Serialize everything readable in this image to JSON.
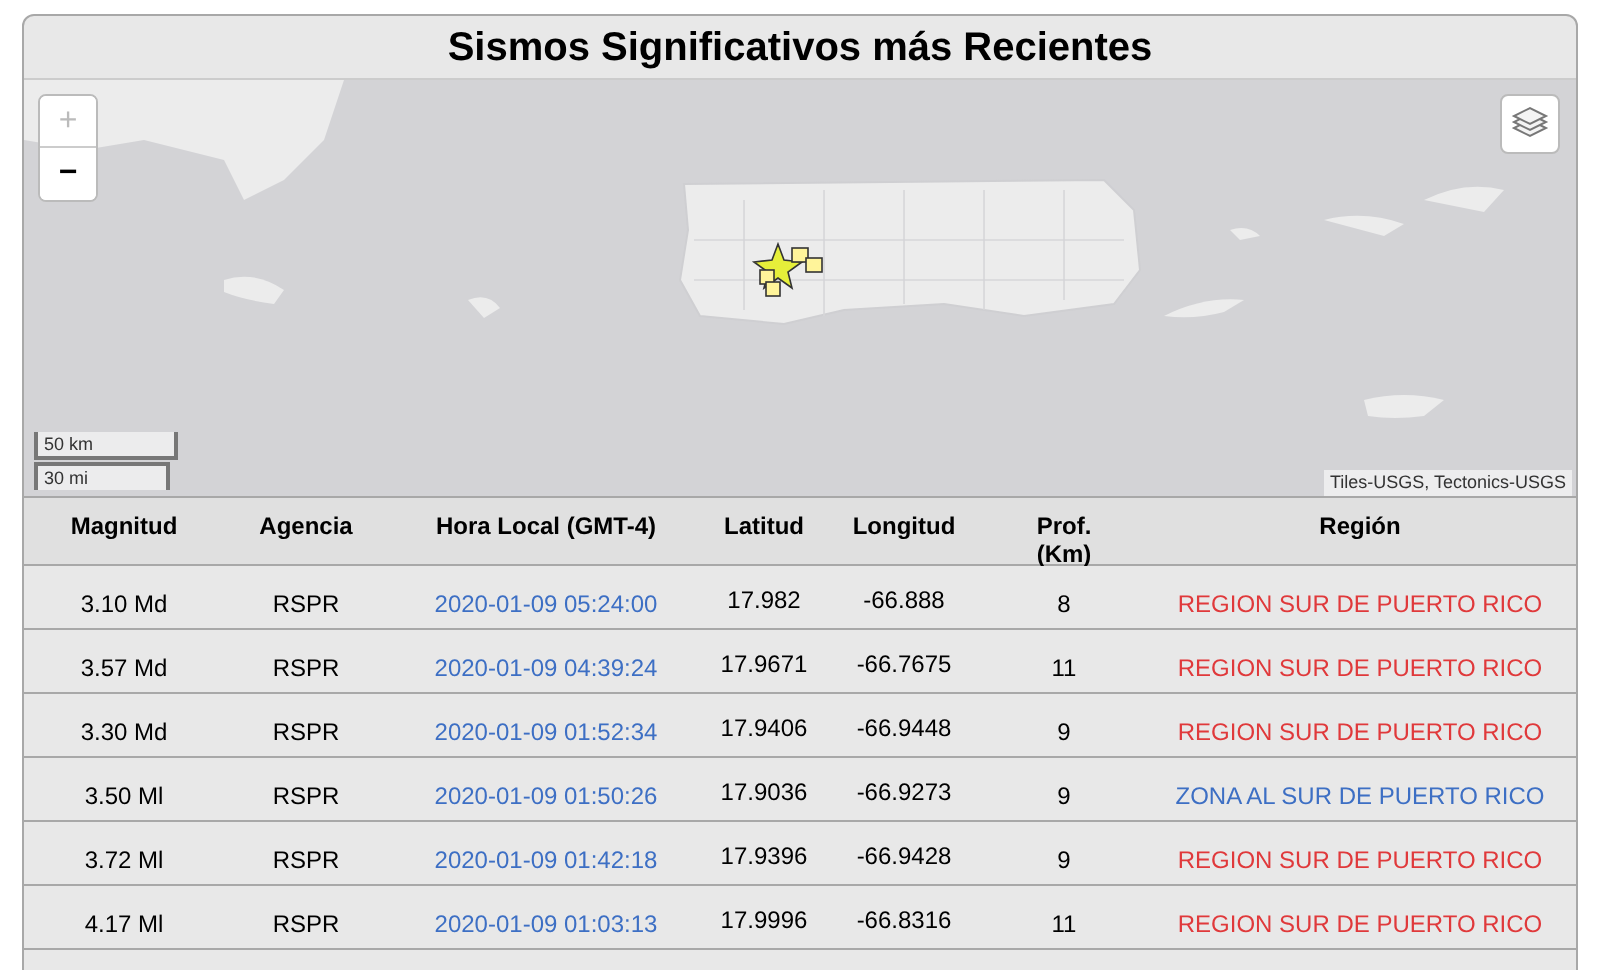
{
  "title": "Sismos Significativos más Recientes",
  "map": {
    "kind": "picture",
    "zoom_in": {
      "label": "+",
      "disabled": true
    },
    "zoom_out": {
      "label": "−",
      "disabled": false
    },
    "scale": [
      "50 km",
      "30 mi"
    ],
    "attribution": "Tiles-USGS, Tectonics-USGS"
  },
  "table": {
    "columns": [
      "Magnitud",
      "Agencia",
      "Hora Local (GMT-4)",
      "Latitud",
      "Longitud",
      "Prof. (Km)",
      "Región"
    ],
    "rows": [
      {
        "magnitude": "3.10 Md",
        "agency": "RSPR",
        "time": "2020-01-09 05:24:00",
        "lat": "17.982",
        "lon": "-66.888",
        "depth": "8",
        "region": "REGION SUR DE PUERTO RICO",
        "color": "#e0393b"
      },
      {
        "magnitude": "3.57 Md",
        "agency": "RSPR",
        "time": "2020-01-09 04:39:24",
        "lat": "17.9671",
        "lon": "-66.7675",
        "depth": "11",
        "region": "REGION SUR DE PUERTO RICO",
        "color": "#e0393b"
      },
      {
        "magnitude": "3.30 Md",
        "agency": "RSPR",
        "time": "2020-01-09 01:52:34",
        "lat": "17.9406",
        "lon": "-66.9448",
        "depth": "9",
        "region": "REGION SUR DE PUERTO RICO",
        "color": "#e0393b"
      },
      {
        "magnitude": "3.50 Ml",
        "agency": "RSPR",
        "time": "2020-01-09 01:50:26",
        "lat": "17.9036",
        "lon": "-66.9273",
        "depth": "9",
        "region": "ZONA AL SUR DE PUERTO RICO",
        "color": "#3d6fc4"
      },
      {
        "magnitude": "3.72 Ml",
        "agency": "RSPR",
        "time": "2020-01-09 01:42:18",
        "lat": "17.9396",
        "lon": "-66.9428",
        "depth": "9",
        "region": "REGION SUR DE PUERTO RICO",
        "color": "#e0393b"
      },
      {
        "magnitude": "4.17 Ml",
        "agency": "RSPR",
        "time": "2020-01-09 01:03:13",
        "lat": "17.9996",
        "lon": "-66.8316",
        "depth": "11",
        "region": "REGION SUR DE PUERTO RICO",
        "color": "#e0393b"
      }
    ]
  }
}
